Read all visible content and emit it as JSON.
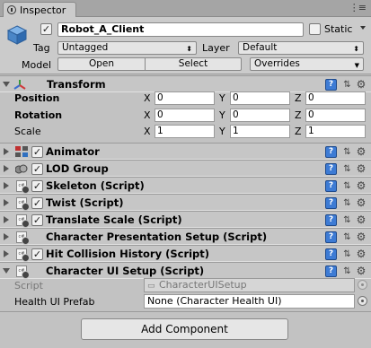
{
  "tab": {
    "label": "Inspector",
    "menu_icon": "kebab-menu-icon"
  },
  "header": {
    "object_name": "Robot_A_Client",
    "active_checked": true,
    "static_label": "Static",
    "tag_label": "Tag",
    "tag_value": "Untagged",
    "layer_label": "Layer",
    "layer_value": "Default",
    "model_label": "Model",
    "open_label": "Open",
    "select_label": "Select",
    "overrides_label": "Overrides"
  },
  "transform": {
    "title": "Transform",
    "rows": [
      {
        "label": "Position",
        "x": "0",
        "y": "0",
        "z": "0"
      },
      {
        "label": "Rotation",
        "x": "0",
        "y": "0",
        "z": "0"
      },
      {
        "label": "Scale",
        "x": "1",
        "y": "1",
        "z": "1"
      }
    ],
    "axis": {
      "x": "X",
      "y": "Y",
      "z": "Z"
    }
  },
  "components": [
    {
      "title": "Animator",
      "enabled": true,
      "icon": "animator-icon"
    },
    {
      "title": "LOD Group",
      "enabled": true,
      "icon": "lod-group-icon"
    },
    {
      "title": "Skeleton (Script)",
      "enabled": true,
      "icon": "script-icon"
    },
    {
      "title": "Twist (Script)",
      "enabled": true,
      "icon": "script-icon"
    },
    {
      "title": "Translate Scale (Script)",
      "enabled": true,
      "icon": "script-icon"
    },
    {
      "title": "Character Presentation Setup (Script)",
      "enabled": null,
      "icon": "script-icon"
    },
    {
      "title": "Hit Collision History (Script)",
      "enabled": true,
      "icon": "script-icon"
    }
  ],
  "character_ui": {
    "title": "Character UI Setup (Script)",
    "script_label": "Script",
    "script_value": "CharacterUISetup",
    "prefab_label": "Health UI Prefab",
    "prefab_value": "None (Character Health UI)"
  },
  "add_component": "Add Component",
  "colors": {
    "background": "#c2c2c2",
    "help_blue": "#3d7bd4"
  }
}
